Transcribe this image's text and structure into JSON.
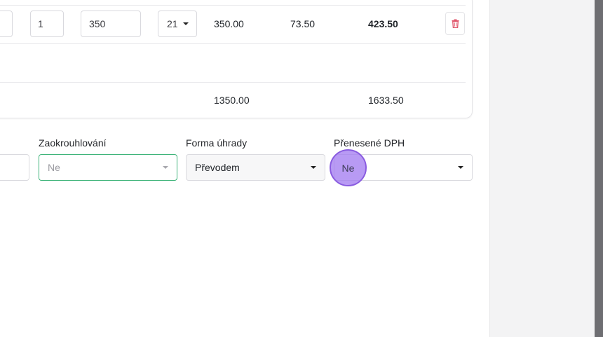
{
  "items": {
    "row": {
      "quantity": "1",
      "unit_price": "350",
      "vat_rate": "21",
      "base": "350.00",
      "vat": "73.50",
      "total": "423.50"
    },
    "totals": {
      "base": "1350.00",
      "total": "1633.50"
    }
  },
  "form": {
    "rounding": {
      "label": "Zaokrouhlování",
      "placeholder": "Ne"
    },
    "payment": {
      "label": "Forma úhrady",
      "value": "Převodem"
    },
    "reverse_charge": {
      "label": "Přenesené DPH",
      "value": "Ne"
    }
  },
  "icons": {
    "delete": "trash-icon"
  },
  "colors": {
    "focus_border": "#3fb47a",
    "delete_icon": "#e0566b",
    "cursor": "#a078f0"
  }
}
